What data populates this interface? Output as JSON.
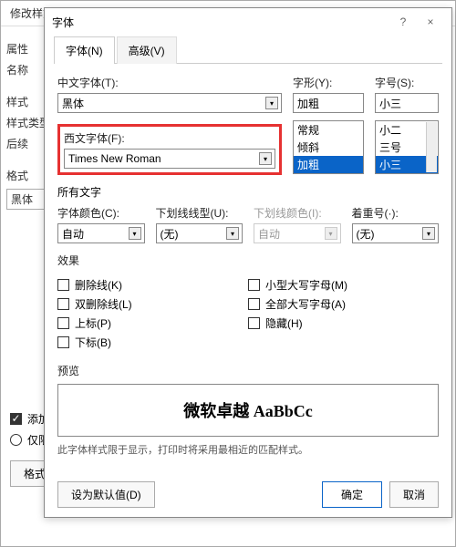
{
  "bg": {
    "title": "修改样式",
    "labels": {
      "prop": "属性",
      "name": "名称",
      "styleGroup": "样式",
      "styleType": "样式类型",
      "follow": "后续",
      "format": "格式",
      "fontBlock": "黑体",
      "add": "添加",
      "onlyThis": "仅限",
      "formatBtn": "格式"
    }
  },
  "dialog": {
    "title": "字体",
    "help": "?",
    "close": "×",
    "tabs": {
      "font": "字体(N)",
      "advanced": "高级(V)"
    },
    "cnFont": {
      "label": "中文字体(T):",
      "value": "黑体"
    },
    "style": {
      "label": "字形(Y):",
      "value": "加粗",
      "options": [
        "常规",
        "倾斜",
        "加粗"
      ],
      "selected": "加粗"
    },
    "size": {
      "label": "字号(S):",
      "value": "小三",
      "options": [
        "小二",
        "三号",
        "小三"
      ],
      "selected": "小三"
    },
    "westFont": {
      "label": "西文字体(F):",
      "value": "Times New Roman"
    },
    "allText": "所有文字",
    "fontColor": {
      "label": "字体颜色(C):",
      "value": "自动"
    },
    "underlineType": {
      "label": "下划线线型(U):",
      "value": "(无)"
    },
    "underlineColor": {
      "label": "下划线颜色(I):",
      "value": "自动"
    },
    "emphasis": {
      "label": "着重号(·):",
      "value": "(无)"
    },
    "effects": {
      "title": "效果",
      "left": [
        "删除线(K)",
        "双删除线(L)",
        "上标(P)",
        "下标(B)"
      ],
      "right": [
        "小型大写字母(M)",
        "全部大写字母(A)",
        "隐藏(H)"
      ]
    },
    "preview": {
      "title": "预览",
      "sample": "微软卓越  AaBbCc"
    },
    "note": "此字体样式限于显示，打印时将采用最相近的匹配样式。",
    "footer": {
      "default": "设为默认值(D)",
      "ok": "确定",
      "cancel": "取消"
    }
  }
}
